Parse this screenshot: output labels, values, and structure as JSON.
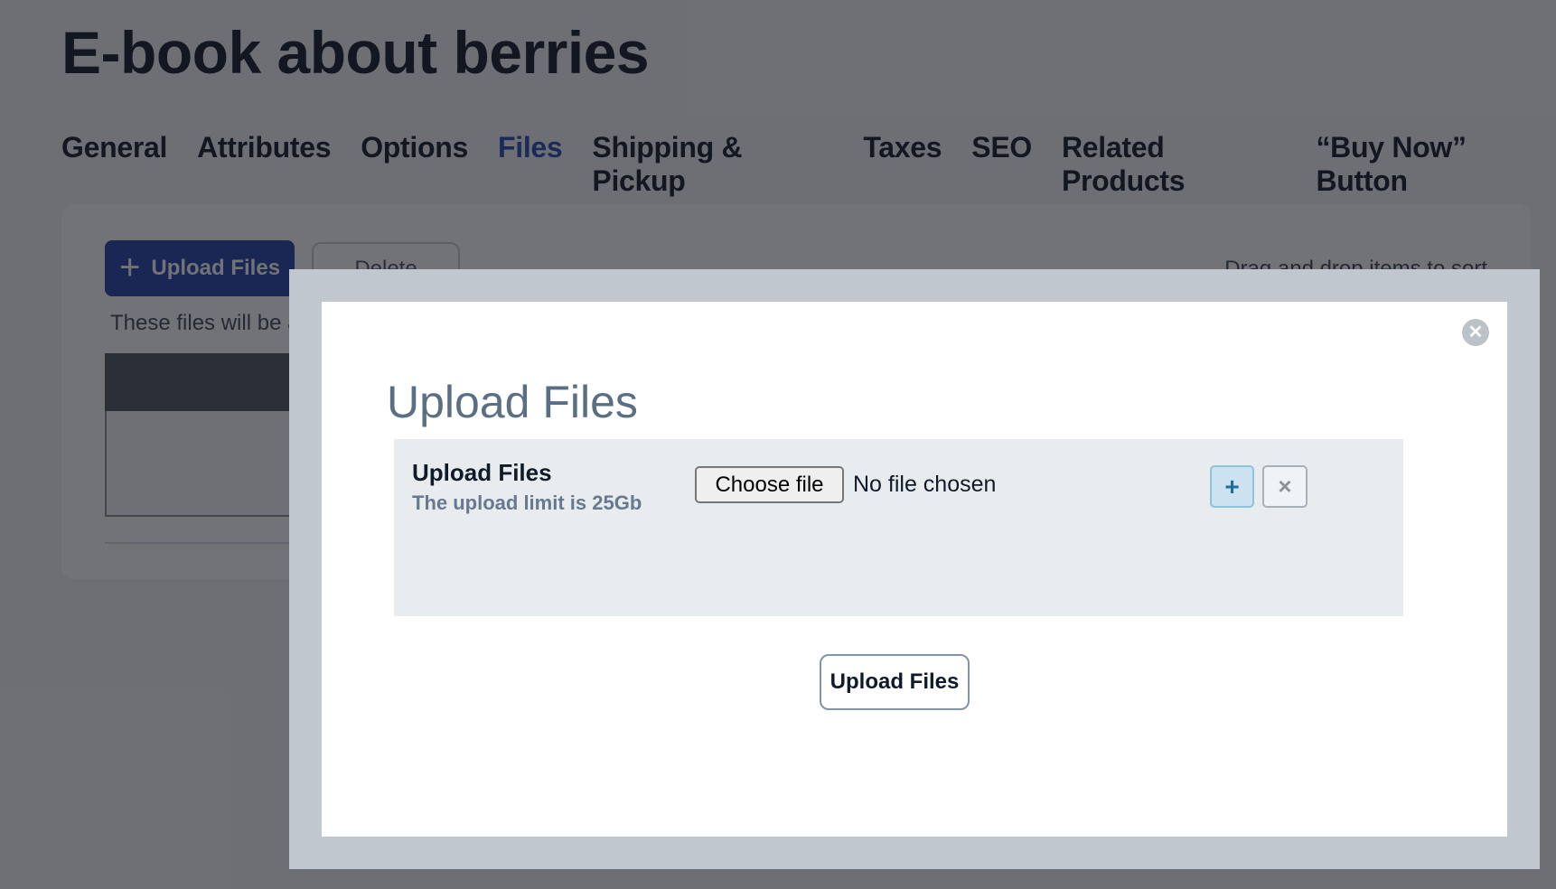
{
  "page": {
    "title": "E-book about berries",
    "tabs": [
      {
        "label": "General",
        "active": false
      },
      {
        "label": "Attributes",
        "active": false
      },
      {
        "label": "Options",
        "active": false
      },
      {
        "label": "Files",
        "active": true
      },
      {
        "label": "Shipping & Pickup",
        "active": false
      },
      {
        "label": "Taxes",
        "active": false
      },
      {
        "label": "SEO",
        "active": false
      },
      {
        "label": "Related Products",
        "active": false
      },
      {
        "label": "“Buy Now” Button",
        "active": false
      }
    ],
    "files_card": {
      "upload_button_label": "Upload Files",
      "delete_button_label": "Delete",
      "note": "These files will be a",
      "drag_note": "Drag and drop items to sort"
    }
  },
  "modal": {
    "title": "Upload Files",
    "close_icon": "close-circle-icon",
    "panel": {
      "label": "Upload Files",
      "hint": "The upload limit is 25Gb",
      "choose_file_label": "Choose file",
      "file_status": "No file chosen",
      "add_icon": "+",
      "remove_icon": "×"
    },
    "submit_label": "Upload Files"
  },
  "colors": {
    "accent": "#2a4ab3",
    "modal_border": "#c0c7cf",
    "panel_bg": "#e9ecef",
    "modal_title": "#5a6e84"
  }
}
